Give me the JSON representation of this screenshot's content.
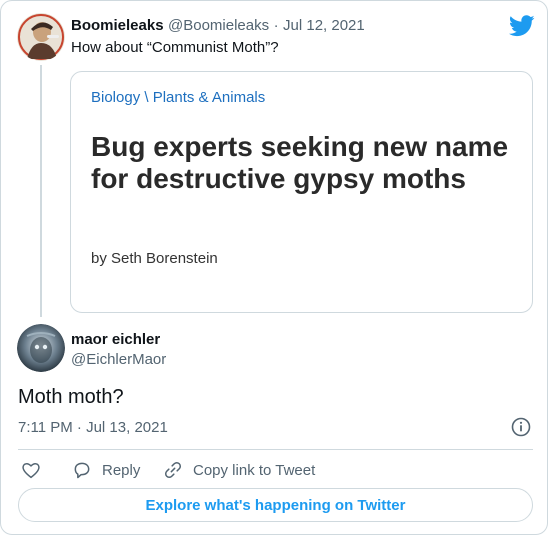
{
  "parent": {
    "name": "Boomieleaks",
    "handle": "@Boomieleaks",
    "separator": "·",
    "date": "Jul 12, 2021",
    "text": "How about “Communist Moth”?"
  },
  "article_card": {
    "breadcrumb": "Biology \\ Plants & Animals",
    "title": "Bug experts seeking new name for destructive gypsy moths",
    "byline": "by Seth Borenstein"
  },
  "reply": {
    "name": "maor eichler",
    "handle": "@EichlerMaor",
    "text": "Moth moth?",
    "timestamp": "7:11 PM · Jul 13, 2021"
  },
  "actions": {
    "reply_label": "Reply",
    "copy_label": "Copy link to Tweet"
  },
  "footer": {
    "explore_label": "Explore what's happening on Twitter"
  },
  "colors": {
    "twitter_blue": "#1d9bf0",
    "link_blue": "#1d6fbf",
    "muted": "#536471",
    "border": "#cfd9de"
  }
}
